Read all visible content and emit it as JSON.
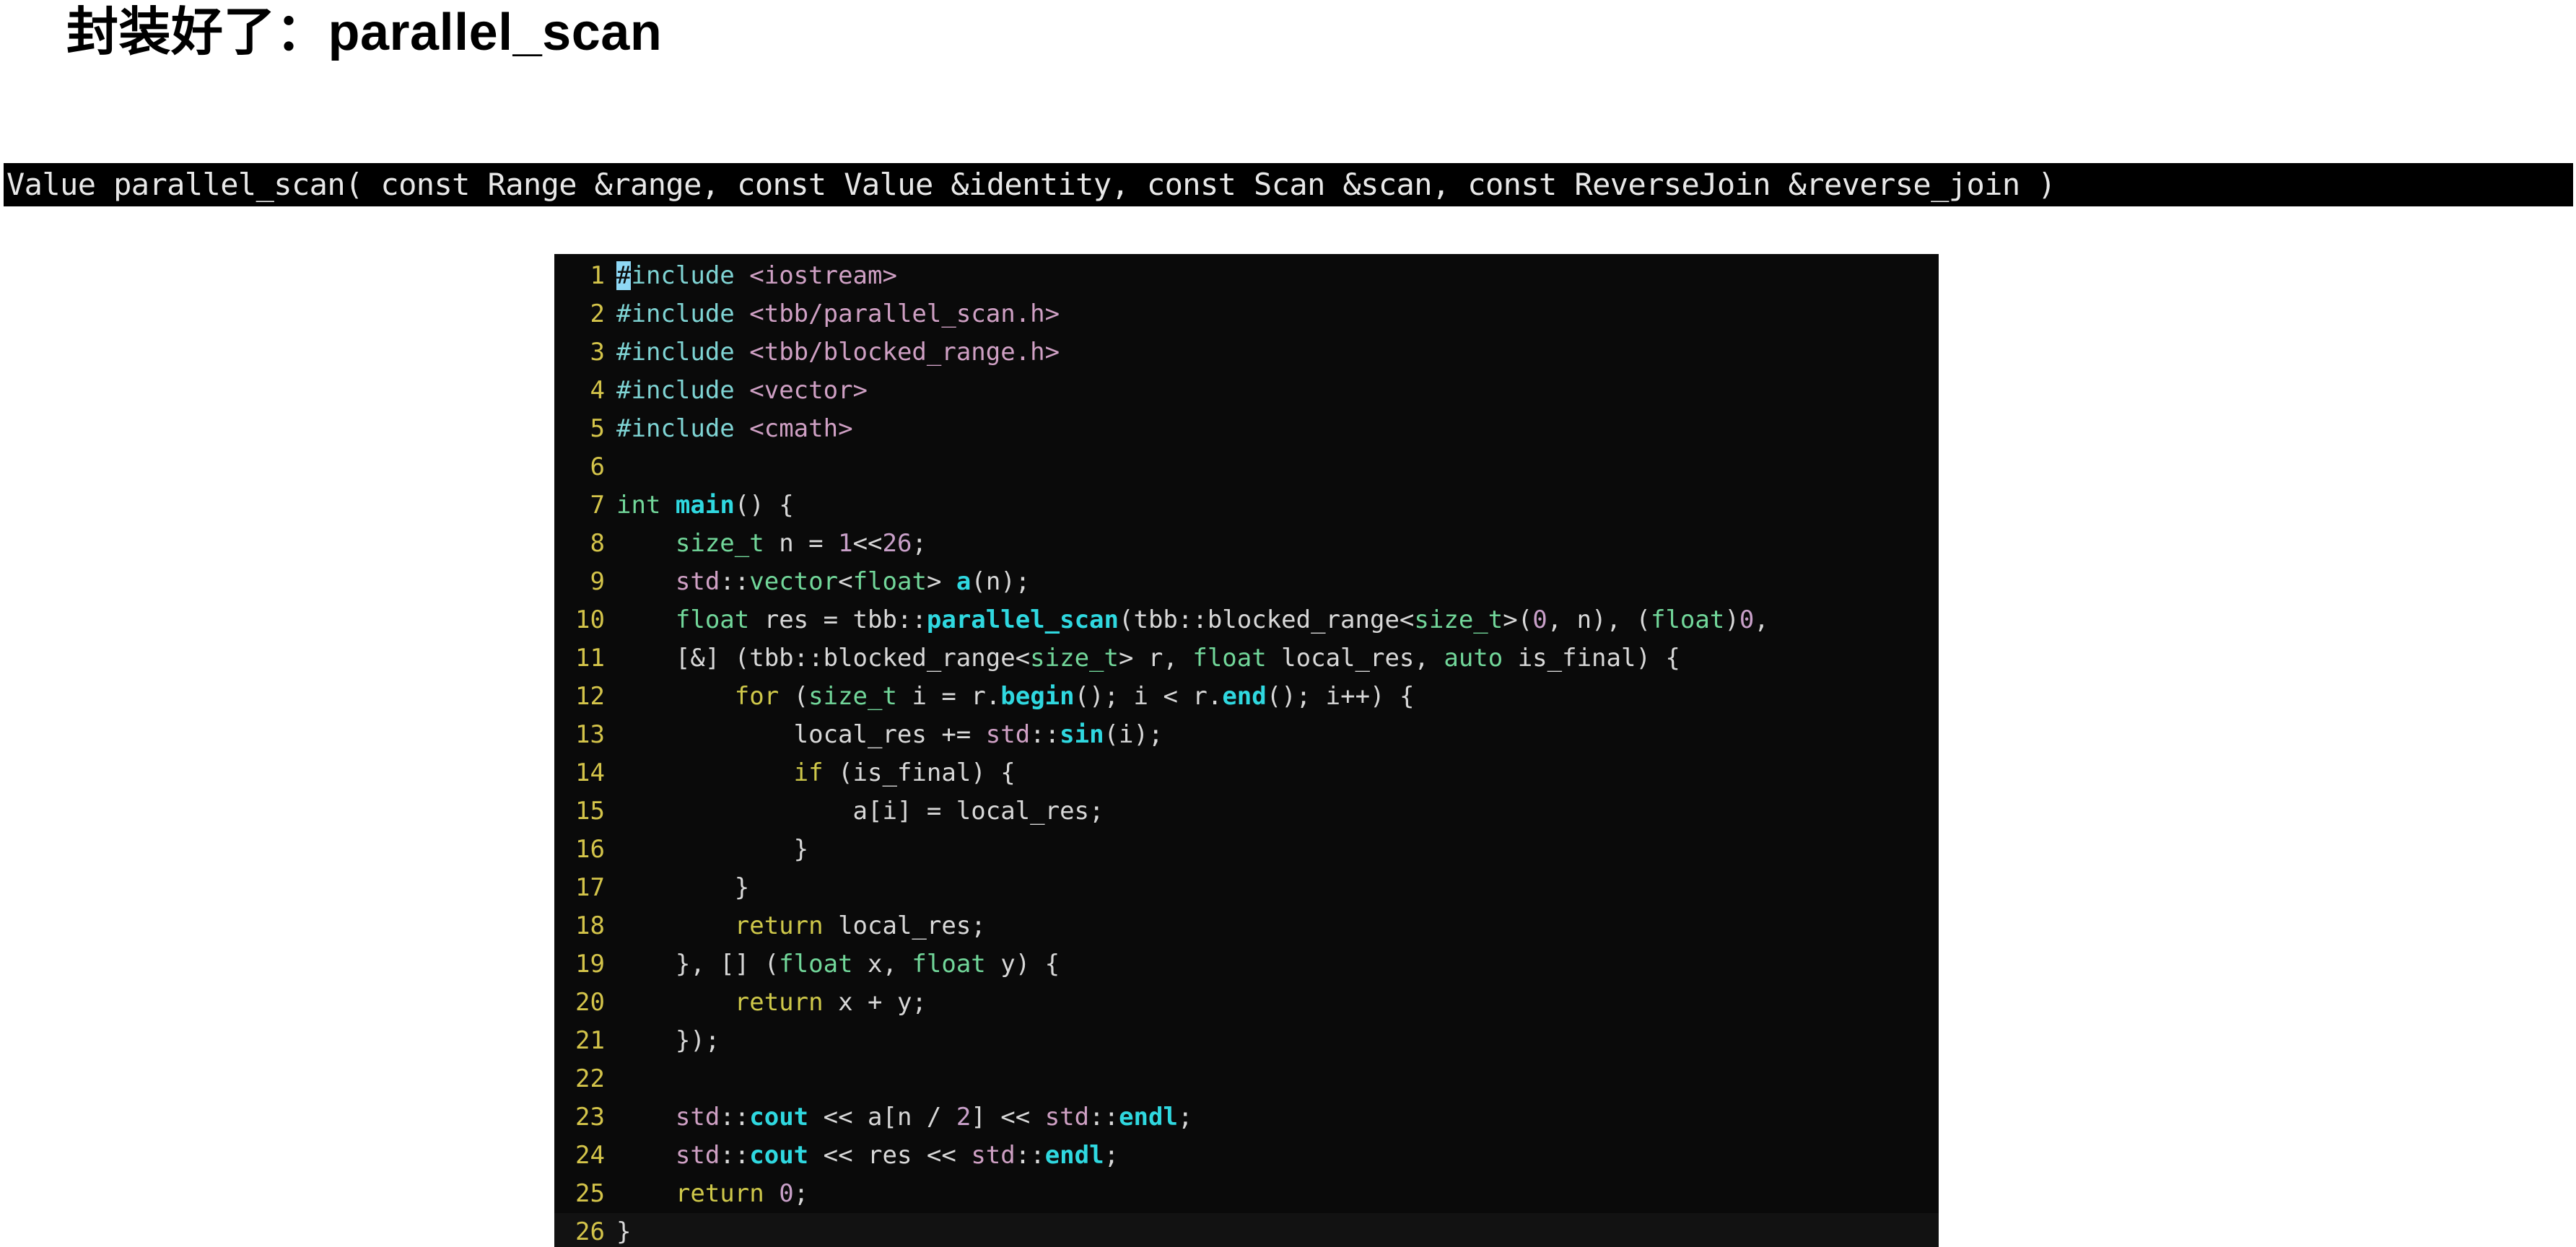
{
  "slide": {
    "title": "封装好了：parallel_scan",
    "background_color": "#ffffff"
  },
  "signature_bar": {
    "text": "Value parallel_scan( const Range &range, const Value &identity, const Scan &scan, const ReverseJoin &reverse_join )",
    "background_color": "#000000",
    "text_color": "#e8e8e8"
  },
  "code_block": {
    "language": "cpp",
    "background_color": "#0a0a0a",
    "line_number_color": "#d4c44a",
    "cursor_color": "#8fd8f5",
    "cursor_line": 1,
    "cursor_column": 1,
    "total_lines": 26,
    "lines": [
      {
        "n": "1",
        "tokens": [
          {
            "t": "#",
            "c": "cursor"
          },
          {
            "t": "include",
            "c": "t-pre"
          },
          {
            "t": " ",
            "c": "t-plain"
          },
          {
            "t": "<iostream>",
            "c": "t-header"
          }
        ]
      },
      {
        "n": "2",
        "tokens": [
          {
            "t": "#include",
            "c": "t-pre"
          },
          {
            "t": " ",
            "c": "t-plain"
          },
          {
            "t": "<tbb/parallel_scan.h>",
            "c": "t-header"
          }
        ]
      },
      {
        "n": "3",
        "tokens": [
          {
            "t": "#include",
            "c": "t-pre"
          },
          {
            "t": " ",
            "c": "t-plain"
          },
          {
            "t": "<tbb/blocked_range.h>",
            "c": "t-header"
          }
        ]
      },
      {
        "n": "4",
        "tokens": [
          {
            "t": "#include",
            "c": "t-pre"
          },
          {
            "t": " ",
            "c": "t-plain"
          },
          {
            "t": "<vector>",
            "c": "t-header"
          }
        ]
      },
      {
        "n": "5",
        "tokens": [
          {
            "t": "#include",
            "c": "t-pre"
          },
          {
            "t": " ",
            "c": "t-plain"
          },
          {
            "t": "<cmath>",
            "c": "t-header"
          }
        ]
      },
      {
        "n": "6",
        "tokens": []
      },
      {
        "n": "7",
        "tokens": [
          {
            "t": "int",
            "c": "t-type"
          },
          {
            "t": " ",
            "c": "t-plain"
          },
          {
            "t": "main",
            "c": "t-fn"
          },
          {
            "t": "() {",
            "c": "t-plain"
          }
        ]
      },
      {
        "n": "8",
        "tokens": [
          {
            "t": "    ",
            "c": "t-plain"
          },
          {
            "t": "size_t",
            "c": "t-type"
          },
          {
            "t": " n = ",
            "c": "t-plain"
          },
          {
            "t": "1",
            "c": "t-num"
          },
          {
            "t": "<<",
            "c": "t-plain"
          },
          {
            "t": "26",
            "c": "t-num"
          },
          {
            "t": ";",
            "c": "t-plain"
          }
        ]
      },
      {
        "n": "9",
        "tokens": [
          {
            "t": "    ",
            "c": "t-plain"
          },
          {
            "t": "std",
            "c": "t-ns"
          },
          {
            "t": "::",
            "c": "t-plain"
          },
          {
            "t": "vector",
            "c": "t-type"
          },
          {
            "t": "<",
            "c": "t-plain"
          },
          {
            "t": "float",
            "c": "t-type"
          },
          {
            "t": "> ",
            "c": "t-plain"
          },
          {
            "t": "a",
            "c": "t-fn"
          },
          {
            "t": "(n);",
            "c": "t-plain"
          }
        ]
      },
      {
        "n": "10",
        "tokens": [
          {
            "t": "    ",
            "c": "t-plain"
          },
          {
            "t": "float",
            "c": "t-type"
          },
          {
            "t": " res = tbb::",
            "c": "t-plain"
          },
          {
            "t": "parallel_scan",
            "c": "t-fn"
          },
          {
            "t": "(tbb::blocked_range<",
            "c": "t-plain"
          },
          {
            "t": "size_t",
            "c": "t-type"
          },
          {
            "t": ">(",
            "c": "t-plain"
          },
          {
            "t": "0",
            "c": "t-num"
          },
          {
            "t": ", n), (",
            "c": "t-plain"
          },
          {
            "t": "float",
            "c": "t-type"
          },
          {
            "t": ")",
            "c": "t-plain"
          },
          {
            "t": "0",
            "c": "t-num"
          },
          {
            "t": ",",
            "c": "t-plain"
          }
        ]
      },
      {
        "n": "11",
        "tokens": [
          {
            "t": "    [&] (tbb::blocked_range<",
            "c": "t-plain"
          },
          {
            "t": "size_t",
            "c": "t-type"
          },
          {
            "t": "> r, ",
            "c": "t-plain"
          },
          {
            "t": "float",
            "c": "t-type"
          },
          {
            "t": " local_res, ",
            "c": "t-plain"
          },
          {
            "t": "auto",
            "c": "t-type"
          },
          {
            "t": " is_final) {",
            "c": "t-plain"
          }
        ]
      },
      {
        "n": "12",
        "tokens": [
          {
            "t": "        ",
            "c": "t-plain"
          },
          {
            "t": "for",
            "c": "t-kw"
          },
          {
            "t": " (",
            "c": "t-plain"
          },
          {
            "t": "size_t",
            "c": "t-type"
          },
          {
            "t": " i = r.",
            "c": "t-plain"
          },
          {
            "t": "begin",
            "c": "t-fn"
          },
          {
            "t": "(); i < r.",
            "c": "t-plain"
          },
          {
            "t": "end",
            "c": "t-fn"
          },
          {
            "t": "(); i++) {",
            "c": "t-plain"
          }
        ]
      },
      {
        "n": "13",
        "tokens": [
          {
            "t": "            local_res += ",
            "c": "t-plain"
          },
          {
            "t": "std",
            "c": "t-ns"
          },
          {
            "t": "::",
            "c": "t-plain"
          },
          {
            "t": "sin",
            "c": "t-fn"
          },
          {
            "t": "(i);",
            "c": "t-plain"
          }
        ]
      },
      {
        "n": "14",
        "tokens": [
          {
            "t": "            ",
            "c": "t-plain"
          },
          {
            "t": "if",
            "c": "t-kw"
          },
          {
            "t": " (is_final) {",
            "c": "t-plain"
          }
        ]
      },
      {
        "n": "15",
        "tokens": [
          {
            "t": "                a[i] = local_res;",
            "c": "t-plain"
          }
        ]
      },
      {
        "n": "16",
        "tokens": [
          {
            "t": "            }",
            "c": "t-plain"
          }
        ]
      },
      {
        "n": "17",
        "tokens": [
          {
            "t": "        }",
            "c": "t-plain"
          }
        ]
      },
      {
        "n": "18",
        "tokens": [
          {
            "t": "        ",
            "c": "t-plain"
          },
          {
            "t": "return",
            "c": "t-kw"
          },
          {
            "t": " local_res;",
            "c": "t-plain"
          }
        ]
      },
      {
        "n": "19",
        "tokens": [
          {
            "t": "    }, [] (",
            "c": "t-plain"
          },
          {
            "t": "float",
            "c": "t-type"
          },
          {
            "t": " x, ",
            "c": "t-plain"
          },
          {
            "t": "float",
            "c": "t-type"
          },
          {
            "t": " y) {",
            "c": "t-plain"
          }
        ]
      },
      {
        "n": "20",
        "tokens": [
          {
            "t": "        ",
            "c": "t-plain"
          },
          {
            "t": "return",
            "c": "t-kw"
          },
          {
            "t": " x + y;",
            "c": "t-plain"
          }
        ]
      },
      {
        "n": "21",
        "tokens": [
          {
            "t": "    });",
            "c": "t-plain"
          }
        ]
      },
      {
        "n": "22",
        "tokens": []
      },
      {
        "n": "23",
        "tokens": [
          {
            "t": "    ",
            "c": "t-plain"
          },
          {
            "t": "std",
            "c": "t-ns"
          },
          {
            "t": "::",
            "c": "t-plain"
          },
          {
            "t": "cout",
            "c": "t-fn"
          },
          {
            "t": " << a[n / ",
            "c": "t-plain"
          },
          {
            "t": "2",
            "c": "t-num"
          },
          {
            "t": "] << ",
            "c": "t-plain"
          },
          {
            "t": "std",
            "c": "t-ns"
          },
          {
            "t": "::",
            "c": "t-plain"
          },
          {
            "t": "endl",
            "c": "t-fn"
          },
          {
            "t": ";",
            "c": "t-plain"
          }
        ]
      },
      {
        "n": "24",
        "tokens": [
          {
            "t": "    ",
            "c": "t-plain"
          },
          {
            "t": "std",
            "c": "t-ns"
          },
          {
            "t": "::",
            "c": "t-plain"
          },
          {
            "t": "cout",
            "c": "t-fn"
          },
          {
            "t": " << res << ",
            "c": "t-plain"
          },
          {
            "t": "std",
            "c": "t-ns"
          },
          {
            "t": "::",
            "c": "t-plain"
          },
          {
            "t": "endl",
            "c": "t-fn"
          },
          {
            "t": ";",
            "c": "t-plain"
          }
        ]
      },
      {
        "n": "25",
        "tokens": [
          {
            "t": "    ",
            "c": "t-plain"
          },
          {
            "t": "return",
            "c": "t-kw"
          },
          {
            "t": " ",
            "c": "t-plain"
          },
          {
            "t": "0",
            "c": "t-num"
          },
          {
            "t": ";",
            "c": "t-plain"
          }
        ]
      },
      {
        "n": "26",
        "tokens": [
          {
            "t": "}",
            "c": "t-plain"
          }
        ],
        "current": true
      }
    ]
  }
}
